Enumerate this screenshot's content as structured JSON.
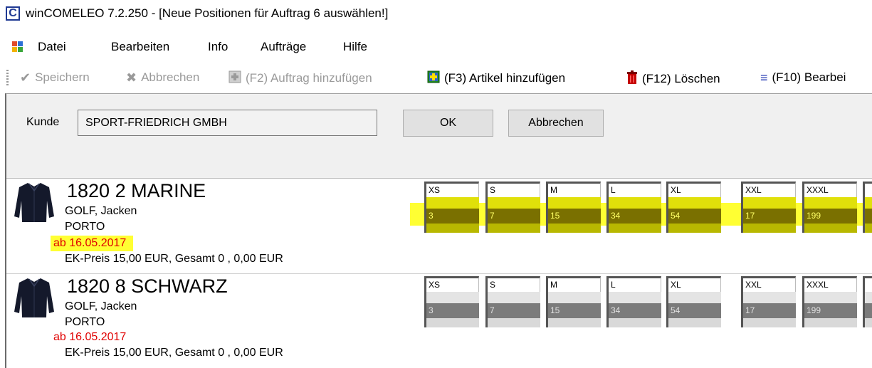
{
  "window": {
    "title": "winCOMELEO 7.2.250 - [Neue Positionen für Auftrag 6 auswählen!]",
    "icon_letter": "C"
  },
  "menu": {
    "items": [
      {
        "label": "Datei"
      },
      {
        "label": "Bearbeiten"
      },
      {
        "label": "Info"
      },
      {
        "label": "Aufträge"
      },
      {
        "label": "Hilfe"
      }
    ]
  },
  "toolbar": {
    "save": "Speichern",
    "cancel": "Abbrechen",
    "add_order": "(F2) Auftrag hinzufügen",
    "add_article": "(F3) Artikel hinzufügen",
    "delete": "(F12) Löschen",
    "edit": "(F10) Bearbei"
  },
  "form": {
    "kunde_label": "Kunde",
    "kunde_value": "SPORT-FRIEDRICH GMBH",
    "ok_label": "OK",
    "cancel_label": "Abbrechen"
  },
  "articles": [
    {
      "number": "1820   2 MARINE",
      "category": "GOLF, Jacken",
      "model": "PORTO",
      "date": "ab 16.05.2017",
      "price": "EK-Preis 15,00 EUR, Gesamt 0 ,  0,00 EUR",
      "highlighted": true,
      "sizes": [
        {
          "size": "XS",
          "qty": "3"
        },
        {
          "size": "S",
          "qty": "7"
        },
        {
          "size": "M",
          "qty": "15"
        },
        {
          "size": "L",
          "qty": "34"
        },
        {
          "size": "XL",
          "qty": "54"
        },
        {
          "size": "XXL",
          "qty": "17"
        },
        {
          "size": "XXXL",
          "qty": "199"
        },
        {
          "size": "",
          "qty": ""
        }
      ]
    },
    {
      "number": "1820   8 SCHWARZ",
      "category": "GOLF, Jacken",
      "model": "PORTO",
      "date": "ab 16.05.2017",
      "price": "EK-Preis 15,00 EUR, Gesamt 0 ,  0,00 EUR",
      "highlighted": false,
      "sizes": [
        {
          "size": "XS",
          "qty": "3"
        },
        {
          "size": "S",
          "qty": "7"
        },
        {
          "size": "M",
          "qty": "15"
        },
        {
          "size": "L",
          "qty": "34"
        },
        {
          "size": "XL",
          "qty": "54"
        },
        {
          "size": "XXL",
          "qty": "17"
        },
        {
          "size": "XXXL",
          "qty": "199"
        },
        {
          "size": "",
          "qty": ""
        }
      ]
    }
  ],
  "colors": {
    "highlight": "#ffff33",
    "date_red": "#e00000"
  }
}
